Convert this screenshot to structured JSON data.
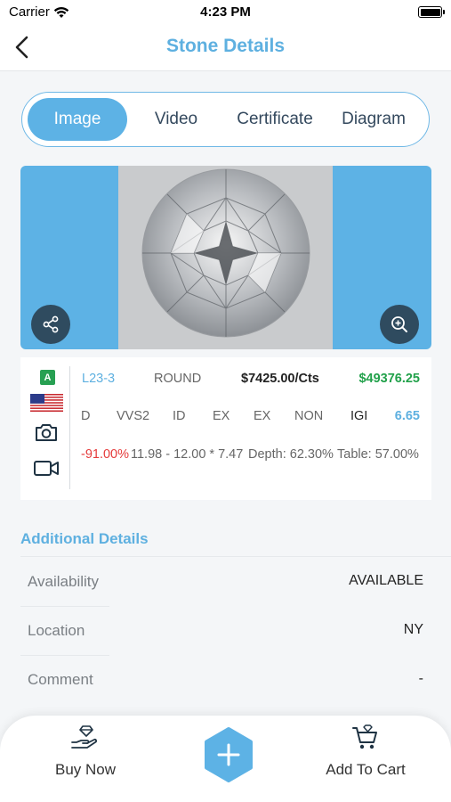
{
  "status_bar": {
    "carrier": "Carrier",
    "time": "4:23 PM"
  },
  "nav": {
    "title": "Stone Details"
  },
  "tabs": [
    {
      "label": "Image",
      "active": true
    },
    {
      "label": "Video",
      "active": false
    },
    {
      "label": "Certificate",
      "active": false
    },
    {
      "label": "Diagram",
      "active": false
    }
  ],
  "stone": {
    "badge": "A",
    "stock_id": "L23-3",
    "shape": "ROUND",
    "price_per_carat": "$7425.00/Cts",
    "total_price": "$49376.25",
    "color": "D",
    "clarity": "VVS2",
    "cut": "ID",
    "polish": "EX",
    "symmetry": "EX",
    "fluorescence": "NON",
    "lab": "IGI",
    "carat": "6.65",
    "discount": "-91.00%",
    "measurements": "11.98 - 12.00 * 7.47",
    "depth": "Depth: 62.30%",
    "table": "Table: 57.00%"
  },
  "additional": {
    "title": "Additional Details",
    "rows": [
      {
        "label": "Availability",
        "value": "AVAILABLE"
      },
      {
        "label": "Location",
        "value": "NY"
      },
      {
        "label": "Comment",
        "value": "-"
      }
    ]
  },
  "bottom": {
    "buy_now": "Buy Now",
    "add_to_cart": "Add To Cart"
  },
  "colors": {
    "accent": "#5db2e5",
    "title": "#5eb0e0",
    "price_green": "#22a14b",
    "discount_red": "#e53b3b",
    "dark_button": "#2f4b5f"
  }
}
